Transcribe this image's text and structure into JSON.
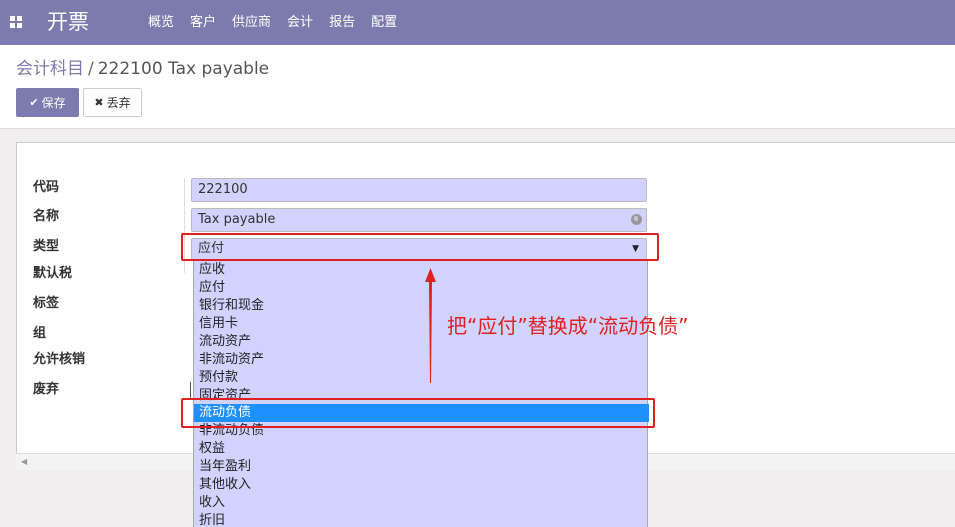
{
  "app": {
    "title": "开票",
    "apps_icon": "grid-icon"
  },
  "menu": [
    "概览",
    "客户",
    "供应商",
    "会计",
    "报告",
    "配置"
  ],
  "breadcrumb": {
    "parent": "会计科目",
    "separator": "/",
    "current": "222100 Tax payable"
  },
  "buttons": {
    "save": "保存",
    "discard": "丢弃",
    "save_icon": "check-icon",
    "discard_icon": "times-icon"
  },
  "form": {
    "labels": {
      "code": "代码",
      "name": "名称",
      "type": "类型",
      "default_tax": "默认税",
      "tags": "标签",
      "group": "组",
      "reconcile": "允许核销",
      "deprecated": "废弃"
    },
    "values": {
      "code": "222100",
      "name": "Tax payable",
      "type": "应付"
    }
  },
  "dropdown": {
    "options": [
      "应收",
      "应付",
      "银行和现金",
      "信用卡",
      "流动资产",
      "非流动资产",
      "预付款",
      "固定资产",
      "流动负债",
      "非流动负债",
      "权益",
      "当年盈利",
      "其他收入",
      "收入",
      "折旧"
    ],
    "highlighted": "流动负债"
  },
  "annotation": {
    "text": "把“应付”替换成“流动负债”",
    "color": "#e02020"
  },
  "colors": {
    "brand": "#7c7bad",
    "field_bg": "#d2d2ff",
    "highlight": "#1e90ff"
  }
}
